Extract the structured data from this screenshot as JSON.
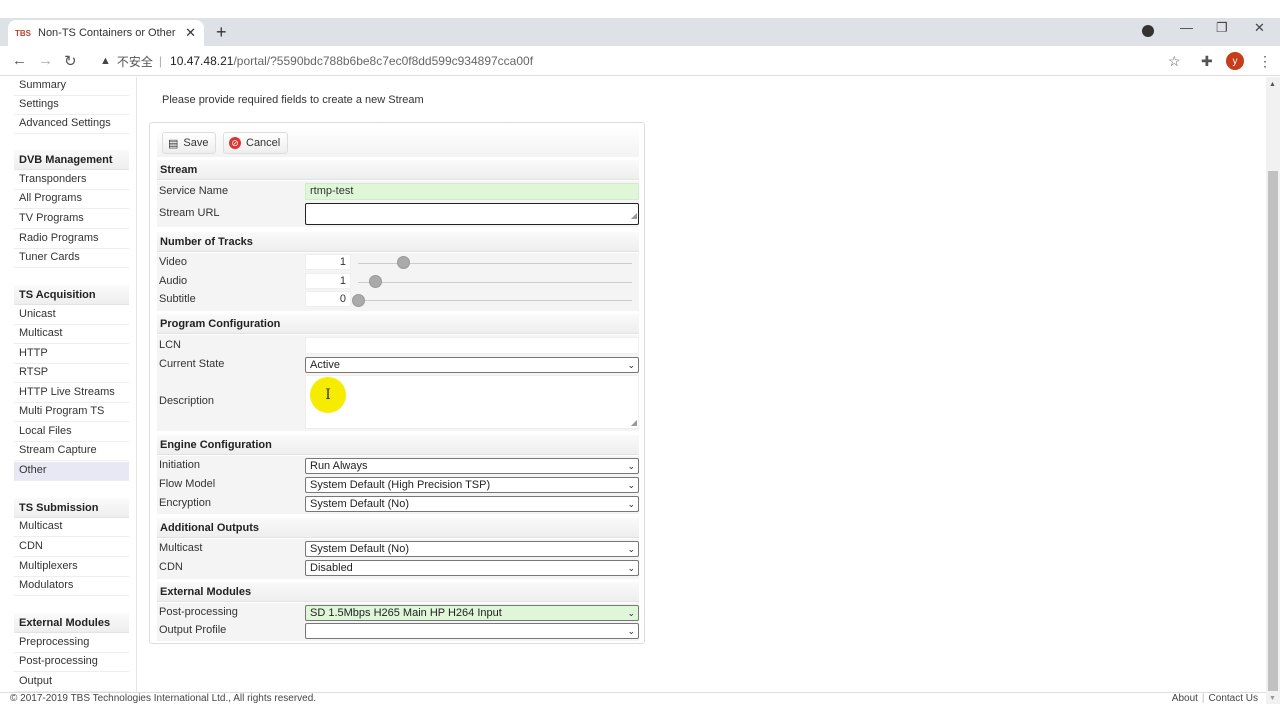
{
  "browser": {
    "tab_title": "Non-TS Containers or Other P",
    "favicon_text": "TBS",
    "url_warning": "不安全",
    "url_host": "10.47.48.21",
    "url_path": "/portal/?5590bdc788b6be8c7ec0f8dd599c934897cca00f",
    "profile_initial": "y"
  },
  "sidebar": {
    "top_items": [
      {
        "label": "Summary"
      },
      {
        "label": "Settings"
      },
      {
        "label": "Advanced Settings"
      }
    ],
    "groups": [
      {
        "title": "DVB Management",
        "items": [
          {
            "label": "Transponders"
          },
          {
            "label": "All Programs"
          },
          {
            "label": "TV Programs"
          },
          {
            "label": "Radio Programs"
          },
          {
            "label": "Tuner Cards"
          }
        ]
      },
      {
        "title": "TS Acquisition",
        "items": [
          {
            "label": "Unicast"
          },
          {
            "label": "Multicast"
          },
          {
            "label": "HTTP"
          },
          {
            "label": "RTSP"
          },
          {
            "label": "HTTP Live Streams"
          },
          {
            "label": "Multi Program TS"
          },
          {
            "label": "Local Files"
          },
          {
            "label": "Stream Capture"
          },
          {
            "label": "Other",
            "active": true
          }
        ]
      },
      {
        "title": "TS Submission",
        "items": [
          {
            "label": "Multicast"
          },
          {
            "label": "CDN"
          },
          {
            "label": "Multiplexers"
          },
          {
            "label": "Modulators"
          }
        ]
      },
      {
        "title": "External Modules",
        "items": [
          {
            "label": "Preprocessing"
          },
          {
            "label": "Post-processing"
          },
          {
            "label": "Output"
          }
        ]
      }
    ]
  },
  "main": {
    "intro": "Please provide required fields to create a new Stream",
    "toolbar": {
      "save_label": "Save",
      "cancel_label": "Cancel"
    },
    "stream": {
      "title": "Stream",
      "service_name_label": "Service Name",
      "service_name_value": "rtmp-test",
      "stream_url_label": "Stream URL",
      "stream_url_value": ""
    },
    "tracks": {
      "title": "Number of Tracks",
      "video_label": "Video",
      "video_value": "1",
      "audio_label": "Audio",
      "audio_value": "1",
      "subtitle_label": "Subtitle",
      "subtitle_value": "0"
    },
    "program": {
      "title": "Program Configuration",
      "lcn_label": "LCN",
      "lcn_value": "",
      "state_label": "Current State",
      "state_value": "Active",
      "description_label": "Description",
      "description_value": ""
    },
    "engine": {
      "title": "Engine Configuration",
      "initiation_label": "Initiation",
      "initiation_value": "Run Always",
      "flow_label": "Flow Model",
      "flow_value": "System Default (High Precision TSP)",
      "encryption_label": "Encryption",
      "encryption_value": "System Default (No)"
    },
    "outputs": {
      "title": "Additional Outputs",
      "multicast_label": "Multicast",
      "multicast_value": "System Default (No)",
      "cdn_label": "CDN",
      "cdn_value": "Disabled"
    },
    "modules": {
      "title": "External Modules",
      "post_label": "Post-processing",
      "post_value": "SD 1.5Mbps H265 Main HP H264 Input",
      "profile_label": "Output Profile",
      "profile_value": ""
    }
  },
  "footer": {
    "copyright": "© 2017-2019 TBS Technologies International Ltd., All rights reserved.",
    "about": "About",
    "contact": "Contact Us"
  }
}
